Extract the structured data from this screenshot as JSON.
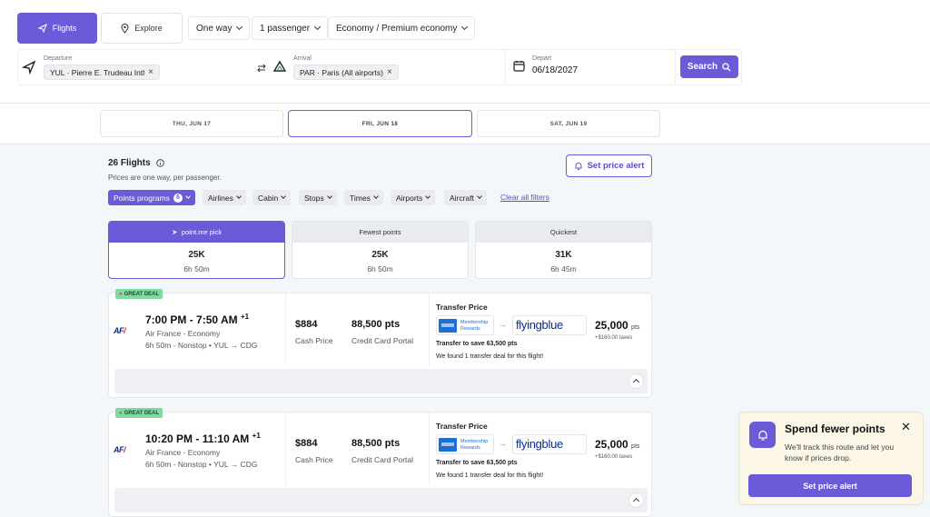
{
  "nav": {
    "flights_label": "Flights",
    "explore_label": "Explore",
    "trip_type": "One way",
    "passengers": "1 passenger",
    "cabin": "Economy / Premium economy"
  },
  "search": {
    "departure_label": "Departure",
    "departure_value": "YUL · Pierre E. Trudeau Intl",
    "arrival_label": "Arrival",
    "arrival_value": "PAR · Paris (All airports)",
    "depart_label": "Depart",
    "depart_value": "06/18/2027",
    "search_label": "Search"
  },
  "dates": [
    {
      "label": "THU, JUN 17",
      "active": false
    },
    {
      "label": "FRI, JUN 18",
      "active": true
    },
    {
      "label": "SAT, JUN 19",
      "active": false
    }
  ],
  "results": {
    "count_label": "26 Flights",
    "note": "Prices are one way, per passenger.",
    "alert_label": "Set price alert"
  },
  "filters": {
    "points_programs": "Points programs",
    "points_programs_count": "6",
    "items": [
      "Airlines",
      "Cabin",
      "Stops",
      "Times",
      "Airports",
      "Aircraft"
    ],
    "clear_label": "Clear all filters"
  },
  "sort": [
    {
      "head": "point.me pick",
      "points": "25K",
      "duration": "6h 50m",
      "active": true
    },
    {
      "head": "Fewest points",
      "points": "25K",
      "duration": "6h 50m",
      "active": false
    },
    {
      "head": "Quickest",
      "points": "31K",
      "duration": "6h 45m",
      "active": false
    }
  ],
  "flights": [
    {
      "deal": "GREAT DEAL",
      "depart_time": "7:00 PM",
      "arrive_time": "7:50 AM",
      "day_offset": "+1",
      "airline": "Air France - Economy",
      "route": "6h 50m - Nonstop • YUL → CDG",
      "cash_price": "$884",
      "cash_label": "Cash Price",
      "portal_pts": "88,500 pts",
      "portal_label": "Credit Card Portal",
      "transfer_title": "Transfer Price",
      "program_from": "Membership Rewards",
      "program_to": "flyingblue",
      "transfer_pts": "25,000",
      "pts_unit": "pts",
      "taxes": "+$160.00 taxes",
      "save": "Transfer to save 63,500 pts",
      "found": "We found 1 transfer deal for this flight!"
    },
    {
      "deal": "GREAT DEAL",
      "depart_time": "10:20 PM",
      "arrive_time": "11:10 AM",
      "day_offset": "+1",
      "airline": "Air France - Economy",
      "route": "6h 50m - Nonstop • YUL → CDG",
      "cash_price": "$884",
      "cash_label": "Cash Price",
      "portal_pts": "88,500 pts",
      "portal_label": "Credit Card Portal",
      "transfer_title": "Transfer Price",
      "program_from": "Membership Rewards",
      "program_to": "flyingblue",
      "transfer_pts": "25,000",
      "pts_unit": "pts",
      "taxes": "+$160.00 taxes",
      "save": "Transfer to save 63,500 pts",
      "found": "We found 1 transfer deal for this flight!"
    }
  ],
  "toast": {
    "title": "Spend fewer points",
    "message": "We'll track this route and let you know if prices drop.",
    "cta": "Set price alert"
  },
  "airline_logo": "AF",
  "colors": {
    "accent": "#6b5bd9",
    "deal": "#7ed9a3",
    "toast_bg": "#fbf6e6"
  }
}
